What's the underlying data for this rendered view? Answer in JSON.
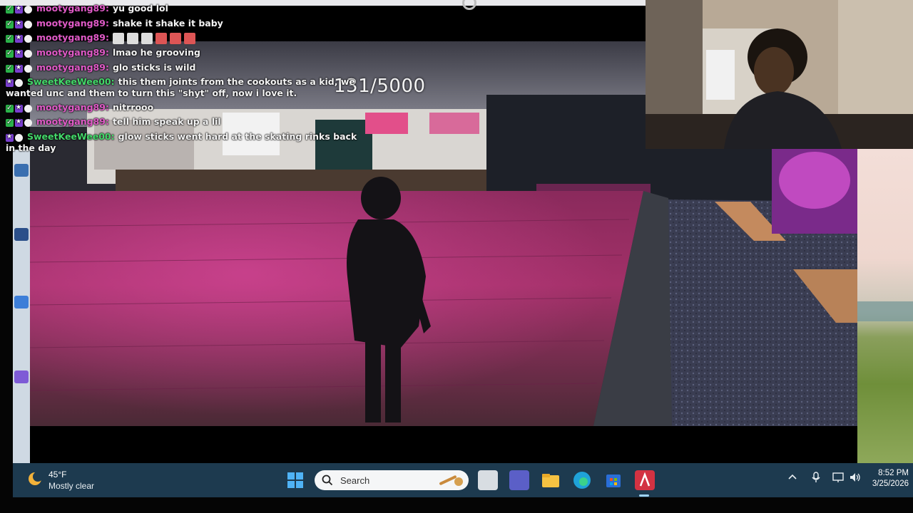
{
  "chat": {
    "messages": [
      {
        "user": "mootygang89:",
        "color": "pink",
        "text": "yu good lol"
      },
      {
        "user": "mootygang89:",
        "color": "pink",
        "text": "shake it shake it baby"
      },
      {
        "user": "mootygang89:",
        "color": "pink",
        "text": "",
        "emotes": true
      },
      {
        "user": "mootygang89:",
        "color": "pink",
        "text": "lmao he grooving"
      },
      {
        "user": "mootygang89:",
        "color": "pink",
        "text": "glo sticks is wild"
      },
      {
        "user": "SweetKeeWee00:",
        "color": "green",
        "text": "this them joints from the cookouts as a kid, we wanted unc and them to turn this \"shyt\" off, now i love it."
      },
      {
        "user": "mootygang89:",
        "color": "pink",
        "text": "nitrrooo"
      },
      {
        "user": "mootygang89:",
        "color": "pink",
        "text": "tell him speak up a lil"
      },
      {
        "user": "SweetKeeWee00:",
        "color": "green",
        "text": "glow sticks went hard at the skating rinks back in the day"
      }
    ]
  },
  "game": {
    "counter": "131/5000"
  },
  "taskbar": {
    "weather_temp": "45°F",
    "weather_desc": "Mostly clear",
    "search_placeholder": "Search",
    "time": "8:52 PM",
    "date": "3/25/2026"
  },
  "colors": {
    "chat_pink": "#e05ac7",
    "chat_green": "#44d86a",
    "taskbar_bg": "#1d3a4f",
    "floor_magenta": "#b0306e"
  }
}
